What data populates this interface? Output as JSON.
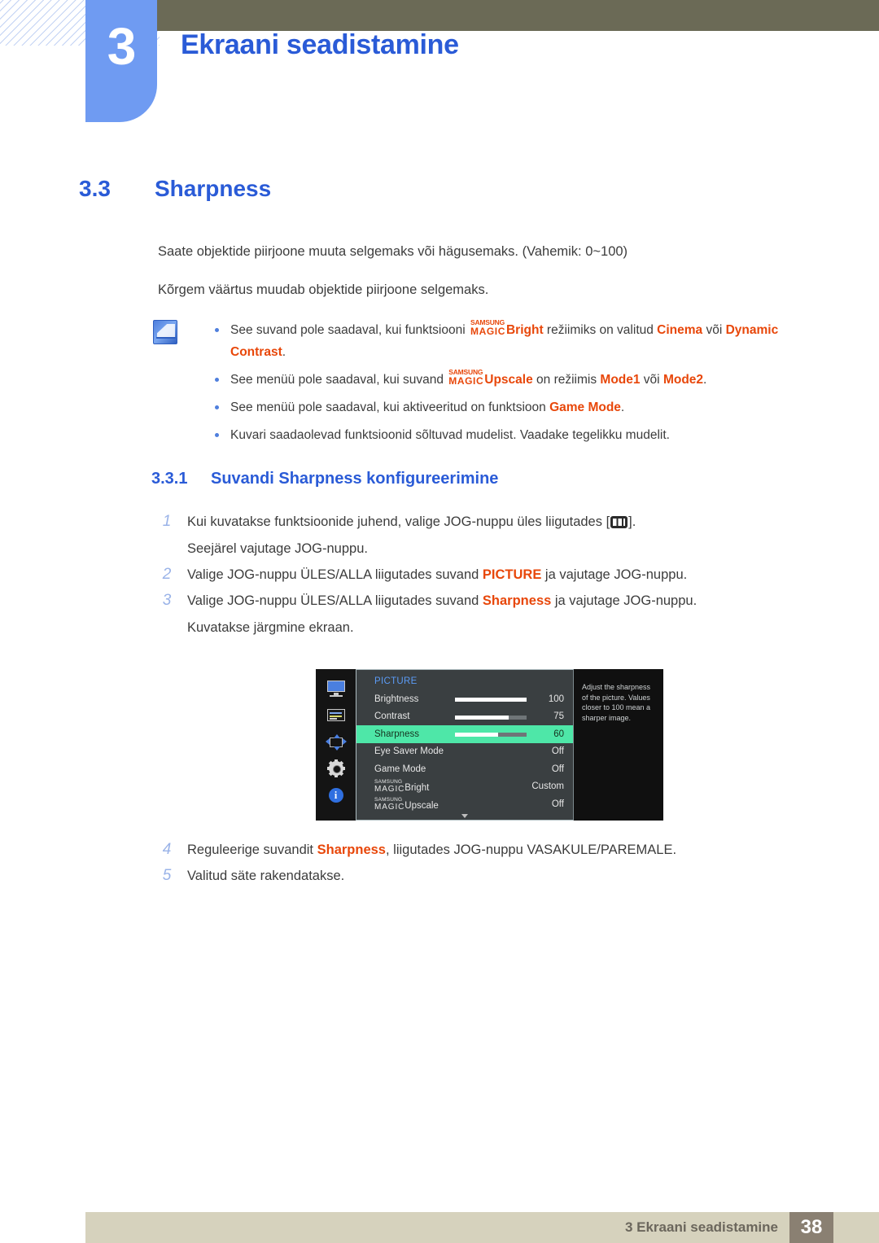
{
  "header": {
    "chapter_number": "3",
    "chapter_title": "Ekraani seadistamine"
  },
  "section": {
    "number": "3.3",
    "title": "Sharpness",
    "paragraphs": [
      "Saate objektide piirjoone muuta selgemaks või hägusemaks. (Vahemik: 0~100)",
      "Kõrgem väärtus muudab objektide piirjoone selgemaks."
    ]
  },
  "note": {
    "icon": "note-pen-icon",
    "bullets": {
      "b1": {
        "pre": "See suvand pole saadaval, kui funktsiooni ",
        "magic_super": "SAMSUNG",
        "magic_main": "MAGIC",
        "magic_word": "Bright",
        "mid": " režiimiks on valitud ",
        "hl1": "Cinema",
        "conj": " või ",
        "hl2": "Dynamic Contrast",
        "post": "."
      },
      "b2": {
        "pre": "See menüü pole saadaval, kui suvand ",
        "magic_super": "SAMSUNG",
        "magic_main": "MAGIC",
        "magic_word": "Upscale",
        "mid": " on režiimis ",
        "hl1": "Mode1",
        "conj": " või ",
        "hl2": "Mode2",
        "post": "."
      },
      "b3": {
        "pre": "See menüü pole saadaval, kui aktiveeritud on funktsioon ",
        "hl1": "Game Mode",
        "post": "."
      },
      "b4": {
        "pre": "Kuvari saadaolevad funktsioonid sõltuvad mudelist. Vaadake tegelikku mudelit."
      }
    }
  },
  "subsection": {
    "number": "3.3.1",
    "title": "Suvandi Sharpness konfigureerimine",
    "steps": [
      {
        "n": "1",
        "pre": "Kui kuvatakse funktsioonide juhend, valige JOG-nuppu üles liigutades [",
        "icon": "jog-menu-icon",
        "post": "].",
        "line2": "Seejärel vajutage JOG-nuppu."
      },
      {
        "n": "2",
        "pre": "Valige JOG-nuppu ÜLES/ALLA liigutades suvand ",
        "hl": "PICTURE",
        "post": " ja vajutage JOG-nuppu.",
        "line2": ""
      },
      {
        "n": "3",
        "pre": "Valige JOG-nuppu ÜLES/ALLA liigutades suvand ",
        "hl": "Sharpness",
        "post": " ja vajutage JOG-nuppu.",
        "line2": "Kuvatakse järgmine ekraan."
      },
      {
        "n": "4",
        "pre": "Reguleerige suvandit ",
        "hl": "Sharpness",
        "post": ", liigutades JOG-nuppu VASAKULE/PAREMALE.",
        "line2": ""
      },
      {
        "n": "5",
        "pre": "Valitud säte rakendatakse.",
        "hl": "",
        "post": "",
        "line2": ""
      }
    ]
  },
  "osd": {
    "title": "PICTURE",
    "sidebar_icons": [
      "monitor-picture-icon",
      "onscreen-display-icon",
      "system-arrows-icon",
      "setup-gear-icon",
      "information-icon"
    ],
    "rows": [
      {
        "label": "Brightness",
        "value": "100",
        "bar": 100,
        "selected": false,
        "has_bar": true
      },
      {
        "label": "Contrast",
        "value": "75",
        "bar": 75,
        "selected": false,
        "has_bar": true
      },
      {
        "label": "Sharpness",
        "value": "60",
        "bar": 60,
        "selected": true,
        "has_bar": true
      },
      {
        "label": "Eye Saver Mode",
        "value": "Off",
        "bar": 0,
        "selected": false,
        "has_bar": false
      },
      {
        "label": "Game Mode",
        "value": "Off",
        "bar": 0,
        "selected": false,
        "has_bar": false
      }
    ],
    "magic_rows": [
      {
        "super": "SAMSUNG",
        "main": "MAGIC",
        "word": "Bright",
        "value": "Custom"
      },
      {
        "super": "SAMSUNG",
        "main": "MAGIC",
        "word": "Upscale",
        "value": "Off"
      }
    ],
    "scroll_caret": "chevron-down-icon",
    "tooltip": "Adjust the sharpness of the picture. Values closer to 100 mean a sharper image."
  },
  "footer": {
    "text": "3 Ekraani seadistamine",
    "page": "38"
  }
}
